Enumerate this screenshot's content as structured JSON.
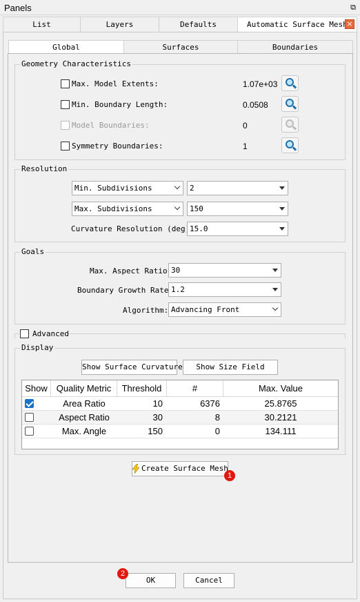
{
  "window": {
    "title": "Panels"
  },
  "top_tabs": [
    "List",
    "Layers",
    "Defaults",
    "Automatic Surface Mesh"
  ],
  "close_glyph": "×",
  "sub_tabs": [
    "Global",
    "Surfaces",
    "Boundaries"
  ],
  "geometry": {
    "title": "Geometry Characteristics",
    "rows": [
      {
        "label": "Max. Model Extents:",
        "value": "1.07e+03"
      },
      {
        "label": "Min. Boundary Length:",
        "value": "0.0508"
      },
      {
        "label": "Model Boundaries:",
        "value": "0"
      },
      {
        "label": "Symmetry Boundaries:",
        "value": "1"
      }
    ]
  },
  "resolution": {
    "title": "Resolution",
    "min_sub_label": "Min. Subdivisions",
    "min_sub_value": "2",
    "max_sub_label": "Max. Subdivisions",
    "max_sub_value": "150",
    "curv_label": "Curvature Resolution (deg):",
    "curv_value": "15.0"
  },
  "goals": {
    "title": "Goals",
    "aspect_label": "Max. Aspect Ratio:",
    "aspect_value": "30",
    "growth_label": "Boundary Growth Rate:",
    "growth_value": "1.2",
    "algo_label": "Algorithm:",
    "algo_value": "Advancing Front"
  },
  "advanced_label": "Advanced",
  "display": {
    "title": "Display",
    "show_curvature": "Show Surface Curvature",
    "show_size": "Show Size Field",
    "columns": [
      "Show",
      "Quality Metric",
      "Threshold",
      "#",
      "Max. Value"
    ],
    "rows": [
      {
        "checked": true,
        "metric": "Area Ratio",
        "threshold": "10",
        "count": "6376",
        "max": "25.8765"
      },
      {
        "checked": false,
        "metric": "Aspect Ratio",
        "threshold": "30",
        "count": "8",
        "max": "30.2121"
      },
      {
        "checked": false,
        "metric": "Max. Angle",
        "threshold": "150",
        "count": "0",
        "max": "134.111"
      }
    ]
  },
  "create_button": "Create Surface Mesh",
  "ok_button": "OK",
  "cancel_button": "Cancel",
  "badges": [
    "1",
    "2"
  ],
  "colors": {
    "accent": "#1a73c8",
    "badge": "#e3170d",
    "close": "#e86a3c"
  }
}
